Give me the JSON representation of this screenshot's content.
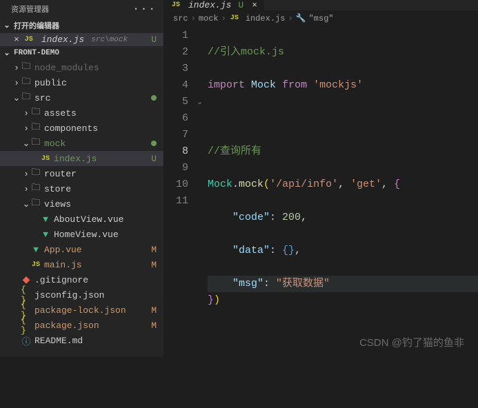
{
  "sidebar": {
    "title": "资源管理器",
    "open_editors_label": "打开的编辑器",
    "open_editor": {
      "file": "index.js",
      "path": "src\\mock",
      "status": "U"
    },
    "project": "FRONT-DEMO",
    "tree": [
      {
        "indent": 1,
        "exp": ">",
        "ico": "folder",
        "label": "node_modules",
        "cls": "dim"
      },
      {
        "indent": 1,
        "exp": ">",
        "ico": "folder",
        "label": "public"
      },
      {
        "indent": 1,
        "exp": "v",
        "ico": "folder",
        "label": "src",
        "dot": true
      },
      {
        "indent": 2,
        "exp": ">",
        "ico": "folder",
        "label": "assets"
      },
      {
        "indent": 2,
        "exp": ">",
        "ico": "folder",
        "label": "components"
      },
      {
        "indent": 2,
        "exp": "v",
        "ico": "folder",
        "label": "mock",
        "cls": "green",
        "dot": true
      },
      {
        "indent": 3,
        "exp": "",
        "ico": "js",
        "label": "index.js",
        "cls": "green sel",
        "status": "U",
        "statusCls": "u"
      },
      {
        "indent": 2,
        "exp": ">",
        "ico": "folder",
        "label": "router"
      },
      {
        "indent": 2,
        "exp": ">",
        "ico": "folder",
        "label": "store"
      },
      {
        "indent": 2,
        "exp": "v",
        "ico": "folder",
        "label": "views"
      },
      {
        "indent": 3,
        "exp": "",
        "ico": "vue",
        "label": "AboutView.vue"
      },
      {
        "indent": 3,
        "exp": "",
        "ico": "vue",
        "label": "HomeView.vue"
      },
      {
        "indent": 2,
        "exp": "",
        "ico": "vue",
        "label": "App.vue",
        "cls": "mod",
        "status": "M"
      },
      {
        "indent": 2,
        "exp": "",
        "ico": "js",
        "label": "main.js",
        "cls": "mod",
        "status": "M"
      },
      {
        "indent": 1,
        "exp": "",
        "ico": "git",
        "label": ".gitignore"
      },
      {
        "indent": 1,
        "exp": "",
        "ico": "brace",
        "label": "jsconfig.json"
      },
      {
        "indent": 1,
        "exp": "",
        "ico": "brace",
        "label": "package-lock.json",
        "cls": "mod",
        "status": "M"
      },
      {
        "indent": 1,
        "exp": "",
        "ico": "brace",
        "label": "package.json",
        "cls": "mod",
        "status": "M"
      },
      {
        "indent": 1,
        "exp": "",
        "ico": "md",
        "label": "README.md"
      }
    ]
  },
  "tab": {
    "file": "index.js",
    "status": "U"
  },
  "breadcrumbs": [
    "src",
    "mock",
    "index.js",
    "\"msg\""
  ],
  "code": {
    "line1_cmt": "//引入mock.js",
    "line2_kw": "import",
    "line2_var": "Mock",
    "line2_from": "from",
    "line2_str": "'mockjs'",
    "line4_cmt": "//查询所有",
    "line5_obj": "Mock",
    "line5_fn": "mock",
    "line5_s1": "'/api/info'",
    "line5_s2": "'get'",
    "line6_k": "\"code\"",
    "line6_v": "200",
    "line7_k": "\"data\"",
    "line8_k": "\"msg\"",
    "line8_v": "\"获取数据\""
  },
  "watermark": "CSDN @钓了猫的鱼非"
}
